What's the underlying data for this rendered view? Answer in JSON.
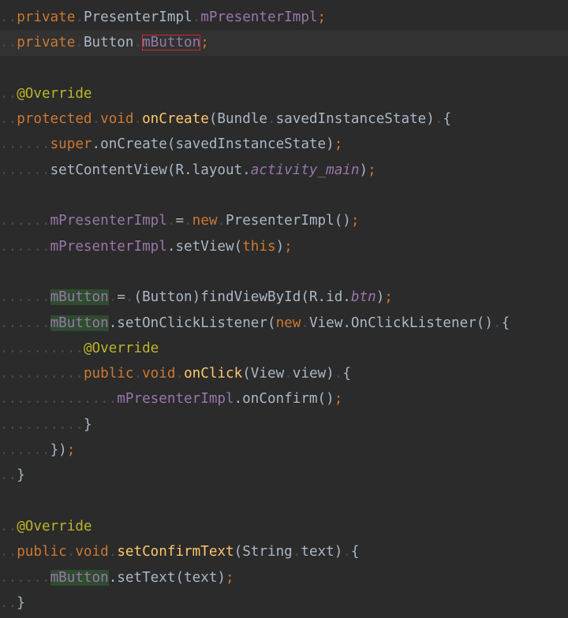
{
  "editor": {
    "lines": [
      {
        "indent": "..",
        "tokens": [
          [
            "kw",
            "private"
          ],
          [
            "dot",
            "."
          ],
          [
            "txt",
            "PresenterImpl"
          ],
          [
            "dot",
            "."
          ],
          [
            "fld",
            "mPresenterImpl"
          ],
          [
            "kw",
            ";"
          ]
        ]
      },
      {
        "indent": "..",
        "current": true,
        "tokens": [
          [
            "kw",
            "private"
          ],
          [
            "dot",
            "."
          ],
          [
            "txt",
            "Button"
          ],
          [
            "dot",
            "."
          ],
          [
            "fld hl-red",
            "mButton"
          ],
          [
            "kw",
            ";"
          ]
        ]
      },
      {
        "indent": "",
        "tokens": []
      },
      {
        "indent": "..",
        "tokens": [
          [
            "ann",
            "@Override"
          ]
        ]
      },
      {
        "indent": "..",
        "tokens": [
          [
            "kw",
            "protected"
          ],
          [
            "dot",
            "."
          ],
          [
            "kw",
            "void"
          ],
          [
            "dot",
            "."
          ],
          [
            "mth",
            "onCreate"
          ],
          [
            "txt",
            "(Bundle"
          ],
          [
            "dot",
            "."
          ],
          [
            "txt",
            "savedInstanceState)"
          ],
          [
            "dot",
            "."
          ],
          [
            "txt",
            "{"
          ]
        ]
      },
      {
        "indent": "......",
        "tokens": [
          [
            "kw",
            "super"
          ],
          [
            "txt",
            ".onCreate(savedInstanceState)"
          ],
          [
            "kw",
            ";"
          ]
        ]
      },
      {
        "indent": "......",
        "tokens": [
          [
            "txt",
            "setContentView(R.layout."
          ],
          [
            "ifld",
            "activity_main"
          ],
          [
            "txt",
            ")"
          ],
          [
            "kw",
            ";"
          ]
        ]
      },
      {
        "indent": "",
        "tokens": []
      },
      {
        "indent": "......",
        "tokens": [
          [
            "fld",
            "mPresenterImpl"
          ],
          [
            "dot",
            "."
          ],
          [
            "txt",
            "="
          ],
          [
            "dot",
            "."
          ],
          [
            "kw",
            "new"
          ],
          [
            "dot",
            "."
          ],
          [
            "txt",
            "PresenterImpl()"
          ],
          [
            "kw",
            ";"
          ]
        ]
      },
      {
        "indent": "......",
        "tokens": [
          [
            "fld",
            "mPresenterImpl"
          ],
          [
            "txt",
            ".setView("
          ],
          [
            "kw",
            "this"
          ],
          [
            "txt",
            ")"
          ],
          [
            "kw",
            ";"
          ]
        ]
      },
      {
        "indent": "",
        "tokens": []
      },
      {
        "indent": "......",
        "tokens": [
          [
            "fld hl-green",
            "mButton"
          ],
          [
            "dot",
            "."
          ],
          [
            "txt",
            "="
          ],
          [
            "dot",
            "."
          ],
          [
            "txt",
            "(Button)findViewById(R.id."
          ],
          [
            "ifld",
            "btn"
          ],
          [
            "txt",
            ")"
          ],
          [
            "kw",
            ";"
          ]
        ]
      },
      {
        "indent": "......",
        "tokens": [
          [
            "fld hl-green",
            "mButton"
          ],
          [
            "txt",
            ".setOnClickListener("
          ],
          [
            "kw",
            "new"
          ],
          [
            "dot",
            "."
          ],
          [
            "txt",
            "View.OnClickListener()"
          ],
          [
            "dot",
            "."
          ],
          [
            "txt",
            "{"
          ]
        ]
      },
      {
        "indent": "..........",
        "tokens": [
          [
            "ann",
            "@Override"
          ]
        ]
      },
      {
        "indent": "..........",
        "tokens": [
          [
            "kw",
            "public"
          ],
          [
            "dot",
            "."
          ],
          [
            "kw",
            "void"
          ],
          [
            "dot",
            "."
          ],
          [
            "mth",
            "onClick"
          ],
          [
            "txt",
            "(View"
          ],
          [
            "dot",
            "."
          ],
          [
            "txt",
            "view)"
          ],
          [
            "dot",
            "."
          ],
          [
            "txt",
            "{"
          ]
        ]
      },
      {
        "indent": "..............",
        "tokens": [
          [
            "fld",
            "mPresenterImpl"
          ],
          [
            "txt",
            ".onConfirm()"
          ],
          [
            "kw",
            ";"
          ]
        ]
      },
      {
        "indent": "..........",
        "tokens": [
          [
            "txt",
            "}"
          ]
        ]
      },
      {
        "indent": "......",
        "tokens": [
          [
            "txt",
            "})"
          ],
          [
            "kw",
            ";"
          ]
        ]
      },
      {
        "indent": "..",
        "tokens": [
          [
            "txt",
            "}"
          ]
        ]
      },
      {
        "indent": "",
        "tokens": []
      },
      {
        "indent": "..",
        "tokens": [
          [
            "ann",
            "@Override"
          ]
        ]
      },
      {
        "indent": "..",
        "tokens": [
          [
            "kw",
            "public"
          ],
          [
            "dot",
            "."
          ],
          [
            "kw",
            "void"
          ],
          [
            "dot",
            "."
          ],
          [
            "mth",
            "setConfirmText"
          ],
          [
            "txt",
            "(String"
          ],
          [
            "dot",
            "."
          ],
          [
            "txt",
            "text)"
          ],
          [
            "dot",
            "."
          ],
          [
            "txt",
            "{"
          ]
        ]
      },
      {
        "indent": "......",
        "tokens": [
          [
            "fld hl-green",
            "mButton"
          ],
          [
            "txt",
            ".setText(text)"
          ],
          [
            "kw",
            ";"
          ]
        ]
      },
      {
        "indent": "..",
        "tokens": [
          [
            "txt",
            "}"
          ]
        ]
      }
    ]
  },
  "colors": {
    "background": "#2b2b2b",
    "current_line": "#323232",
    "keyword": "#cc7832",
    "annotation": "#bbb529",
    "field": "#9876aa",
    "method": "#ffc66d",
    "text": "#a9b7c6",
    "usage_highlight": "#2e4c2e",
    "search_box": "#d22a2a"
  }
}
